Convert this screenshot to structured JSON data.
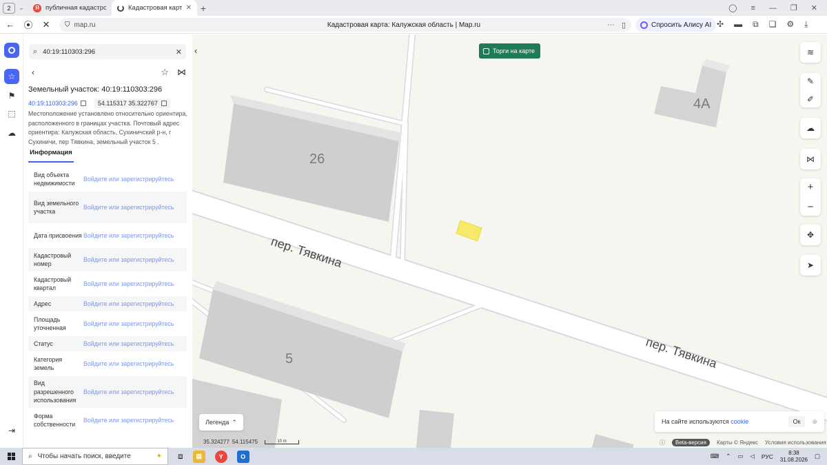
{
  "browser": {
    "tab_count": "2",
    "tabs": [
      {
        "label": "публичная кадастровая к"
      },
      {
        "label": "Кадастровая карта: Ка"
      }
    ],
    "url": "map.ru",
    "page_title": "Кадастровая карта: Калужская область | Map.ru",
    "alice_label": "Спросить Алису AI"
  },
  "search": {
    "value": "40:19:110303:296"
  },
  "plot": {
    "title": "Земельный участок: 40:19:110303:296",
    "cadastral_link": "40:19:110303:296",
    "coords": "54.115317 35.322767",
    "description": "Местоположение установлено относительно ориентира, расположенного в границах участка. Почтовый адрес ориентира: Калужская область, Сухиничский р-н, г Сухиничи, пер Тявкина, земельный участок 5 ."
  },
  "info_tab_label": "Информация",
  "info_rows": [
    {
      "key": "Вид объекта недвижимости",
      "value": "Войдите или зарегистрируйтесь"
    },
    {
      "key": "Вид земельного участка",
      "value": "Войдите или зарегистрируйтесь"
    },
    {
      "key": "Дата присвоения",
      "value": "Войдите или зарегистрируйтесь"
    },
    {
      "key": "Кадастровый номер",
      "value": "Войдите или зарегистрируйтесь"
    },
    {
      "key": "Кадастровый квартал",
      "value": "Войдите или зарегистрируйтесь"
    },
    {
      "key": "Адрес",
      "value": "Войдите или зарегистрируйтесь"
    },
    {
      "key": "Площадь уточненная",
      "value": "Войдите или зарегистрируйтесь"
    },
    {
      "key": "Статус",
      "value": "Войдите или зарегистрируйтесь"
    },
    {
      "key": "Категория земель",
      "value": "Войдите или зарегистрируйтесь"
    },
    {
      "key": "Вид разрешенного использования",
      "value": "Войдите или зарегистрируйтесь"
    },
    {
      "key": "Форма собственности",
      "value": "Войдите или зарегистрируйтесь"
    }
  ],
  "map": {
    "torgi_label": "Торги на карте",
    "buildings": [
      "4А",
      "26",
      "5"
    ],
    "street_label": "пер. Тявкина",
    "legend_label": "Легенда",
    "cursor_lon": "35.324277",
    "cursor_lat": "54.115475",
    "scale_label": "10 m",
    "cookie_text": "На сайте используются",
    "cookie_link": "cookie",
    "cookie_ok": "Ок",
    "beta_label": "Beta-версия",
    "attribution": "Карты © Яндекс",
    "terms": "Условия использования"
  },
  "taskbar": {
    "search_placeholder": "Чтобы начать поиск, введите",
    "lang": "РУС",
    "time": "8:38",
    "date": "31.08.2026"
  },
  "colors": {
    "accent": "#4a66f0",
    "torgi_green": "#1e7a57",
    "parcel_yellow": "#f7ea6a"
  }
}
